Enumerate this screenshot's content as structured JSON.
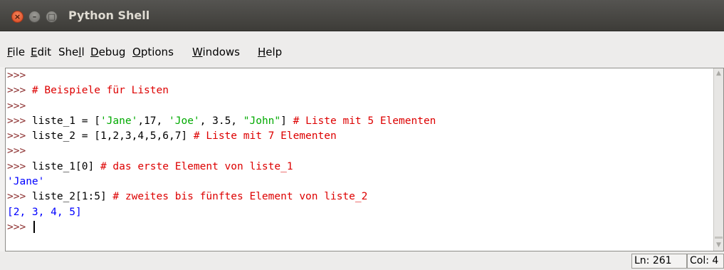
{
  "window": {
    "title": "Python Shell",
    "buttons": {
      "close": "×",
      "minimize": "–",
      "maximize": "□"
    }
  },
  "menu": [
    {
      "pre": "",
      "u": "F",
      "post": "ile"
    },
    {
      "pre": "",
      "u": "E",
      "post": "dit"
    },
    {
      "pre": "She",
      "u": "l",
      "post": "l"
    },
    {
      "pre": "",
      "u": "D",
      "post": "ebug"
    },
    {
      "pre": "",
      "u": "O",
      "post": "ptions"
    },
    {
      "pre": "",
      "u": "W",
      "post": "indows"
    },
    {
      "pre": "",
      "u": "H",
      "post": "elp"
    }
  ],
  "shell": {
    "lines": [
      [
        {
          "t": ">>>",
          "c": "prompt"
        }
      ],
      [
        {
          "t": ">>> ",
          "c": "prompt"
        },
        {
          "t": "# Beispiele für Listen",
          "c": "comment"
        }
      ],
      [
        {
          "t": ">>>",
          "c": "prompt"
        }
      ],
      [
        {
          "t": ">>> ",
          "c": "prompt"
        },
        {
          "t": "liste_1 = [",
          "c": "code"
        },
        {
          "t": "'Jane'",
          "c": "str"
        },
        {
          "t": ",17, ",
          "c": "code"
        },
        {
          "t": "'Joe'",
          "c": "str"
        },
        {
          "t": ", 3.5, ",
          "c": "code"
        },
        {
          "t": "\"John\"",
          "c": "str"
        },
        {
          "t": "] ",
          "c": "code"
        },
        {
          "t": "# Liste mit 5 Elementen",
          "c": "comment"
        }
      ],
      [
        {
          "t": ">>> ",
          "c": "prompt"
        },
        {
          "t": "liste_2 = [1,2,3,4,5,6,7] ",
          "c": "code"
        },
        {
          "t": "# Liste mit 7 Elementen",
          "c": "comment"
        }
      ],
      [
        {
          "t": ">>>",
          "c": "prompt"
        }
      ],
      [
        {
          "t": ">>> ",
          "c": "prompt"
        },
        {
          "t": "liste_1[0] ",
          "c": "code"
        },
        {
          "t": "# das erste Element von liste_1",
          "c": "comment"
        }
      ],
      [
        {
          "t": "'Jane'",
          "c": "out"
        }
      ],
      [
        {
          "t": ">>> ",
          "c": "prompt"
        },
        {
          "t": "liste_2[1:5] ",
          "c": "code"
        },
        {
          "t": "# zweites bis fünftes Element von liste_2",
          "c": "comment"
        }
      ],
      [
        {
          "t": "[2, 3, 4, 5]",
          "c": "out"
        }
      ],
      [
        {
          "t": ">>> ",
          "c": "prompt"
        }
      ]
    ]
  },
  "status": {
    "line": "Ln: 261",
    "col": "Col: 4"
  },
  "colors": {
    "prompt": "#8b2d2d",
    "comment": "#dd0000",
    "string": "#00aa00",
    "output": "#0000ff",
    "close_button": "#e0552c"
  }
}
